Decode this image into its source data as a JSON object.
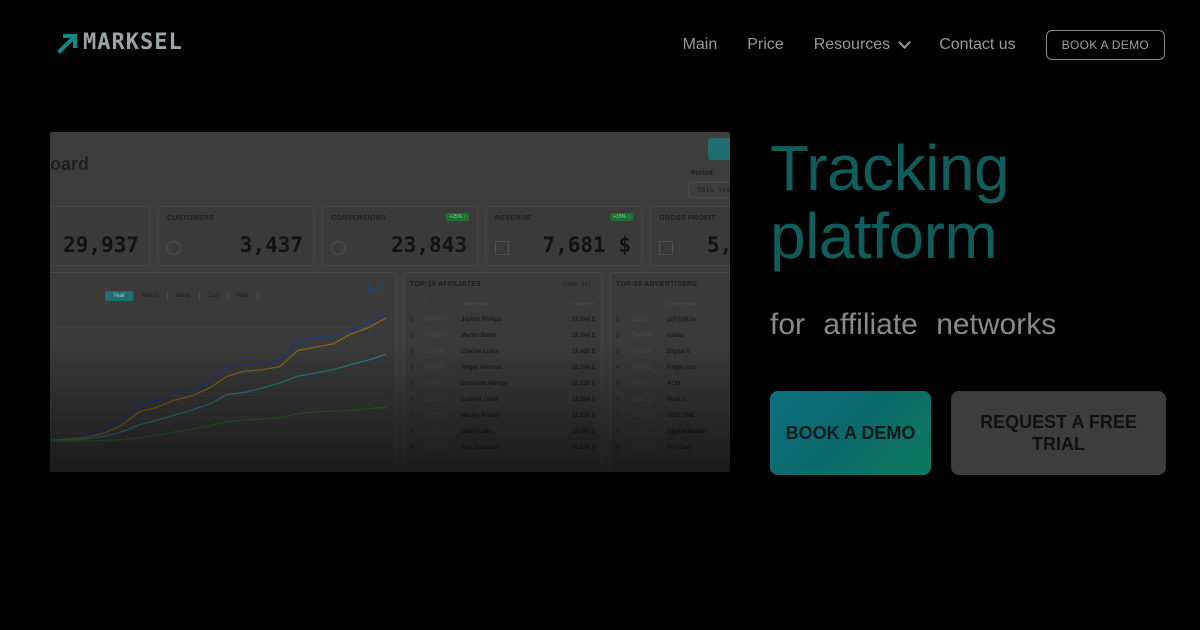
{
  "logo": {
    "text": "MARKSEL"
  },
  "nav": {
    "items": [
      "Main",
      "Price",
      "Resources",
      "Contact us"
    ],
    "cta": "BOOK A DEMO"
  },
  "dashboard": {
    "title": "oard",
    "period_label": "Period",
    "period_value": "This Yea",
    "kpis": [
      {
        "label": "",
        "value": "29,937"
      },
      {
        "label": "CUSTOMERS",
        "value": "3,437"
      },
      {
        "label": "CONVERSIONS",
        "value": "23,843",
        "badge": "+25% ↑"
      },
      {
        "label": "REVENUE",
        "value": "7,681 $",
        "badge": "+15% ↑"
      },
      {
        "label": "GROSS PROFIT",
        "value": "5,"
      }
    ],
    "tabs": [
      "Year",
      "Month",
      "Week",
      "Day",
      "Hour"
    ],
    "affiliates": {
      "title": "TOP-10 AFFILIATES",
      "active": "Active: 342",
      "header": [
        "#",
        "ID",
        "Affiliate Name",
        "Gross Profit"
      ],
      "rows": [
        [
          "1",
          "647663",
          "Jaylon Philips",
          "37,544 $"
        ],
        [
          "2",
          "348382",
          "Martin Botor",
          "26,344 $"
        ],
        [
          "3",
          "233444",
          "Charlie Lubin",
          "19,456 $"
        ],
        [
          "4",
          "455674",
          "Roger Vetrovs",
          "16,344 $"
        ],
        [
          "5",
          "843655",
          "Emerson Mango",
          "15,235 $"
        ],
        [
          "6",
          "345265",
          "Cooper Geidt",
          "13,564 $"
        ],
        [
          "7",
          "645566",
          "Marley Franci",
          "12,234 $"
        ],
        [
          "8",
          "567332",
          "Brain Levin",
          "10,345 $"
        ],
        [
          "9",
          "346745",
          "Ann Davison",
          "10,124 $"
        ]
      ]
    },
    "advertisers": {
      "title": "TOP-10 ADVERTISERS",
      "header": [
        "#",
        "ID",
        "Advertiser Name"
      ],
      "rows": [
        [
          "1",
          "312312",
          "jdjf@jdj.io"
        ],
        [
          "2",
          "234348",
          "Nidsa"
        ],
        [
          "3",
          "234334",
          "Digital 8"
        ],
        [
          "4",
          "234435",
          "Roger ons"
        ],
        [
          "5",
          "435342",
          "AGH"
        ],
        [
          "6",
          "234812",
          "Mark 1"
        ],
        [
          "7",
          "234335",
          "SMS ONE"
        ],
        [
          "8",
          "345231",
          "Digital Market"
        ],
        [
          "9",
          "423145",
          "Fox Den"
        ]
      ]
    }
  },
  "chart_data": {
    "type": "line",
    "x": [
      0,
      1,
      2,
      3,
      4,
      5,
      6,
      7,
      8,
      9,
      10,
      11,
      12,
      13,
      14,
      15,
      16,
      17,
      18,
      19
    ],
    "series": [
      {
        "values": [
          2,
          4,
          8,
          18,
          32,
          55,
          62,
          75,
          78,
          92,
          115,
          118,
          120,
          125,
          155,
          160,
          162,
          170,
          182,
          198
        ],
        "color": "#1f3a78"
      },
      {
        "values": [
          1,
          3,
          6,
          12,
          24,
          45,
          52,
          63,
          70,
          82,
          100,
          108,
          110,
          115,
          140,
          145,
          150,
          165,
          175,
          190
        ],
        "color": "#8a6520"
      },
      {
        "values": [
          0,
          1,
          3,
          7,
          14,
          25,
          32,
          40,
          48,
          57,
          72,
          75,
          82,
          90,
          100,
          105,
          110,
          118,
          125,
          134
        ],
        "color": "#2a7a8a"
      },
      {
        "values": [
          0,
          0,
          0,
          1,
          2,
          5,
          9,
          14,
          18,
          24,
          30,
          32,
          34,
          36,
          42,
          45,
          46,
          47,
          50,
          52
        ],
        "color": "#2a6a2a"
      }
    ],
    "ylim": [
      0,
      210
    ],
    "grid": true
  },
  "hero": {
    "title_line1": "Tracking",
    "title_line2": "platform",
    "subtitle": "for affiliate networks",
    "primary": "BOOK A DEMO",
    "secondary": "REQUEST A FREE TRIAL"
  },
  "colors": {
    "accent_teal": "#0f5e5c",
    "background": "#000000"
  }
}
